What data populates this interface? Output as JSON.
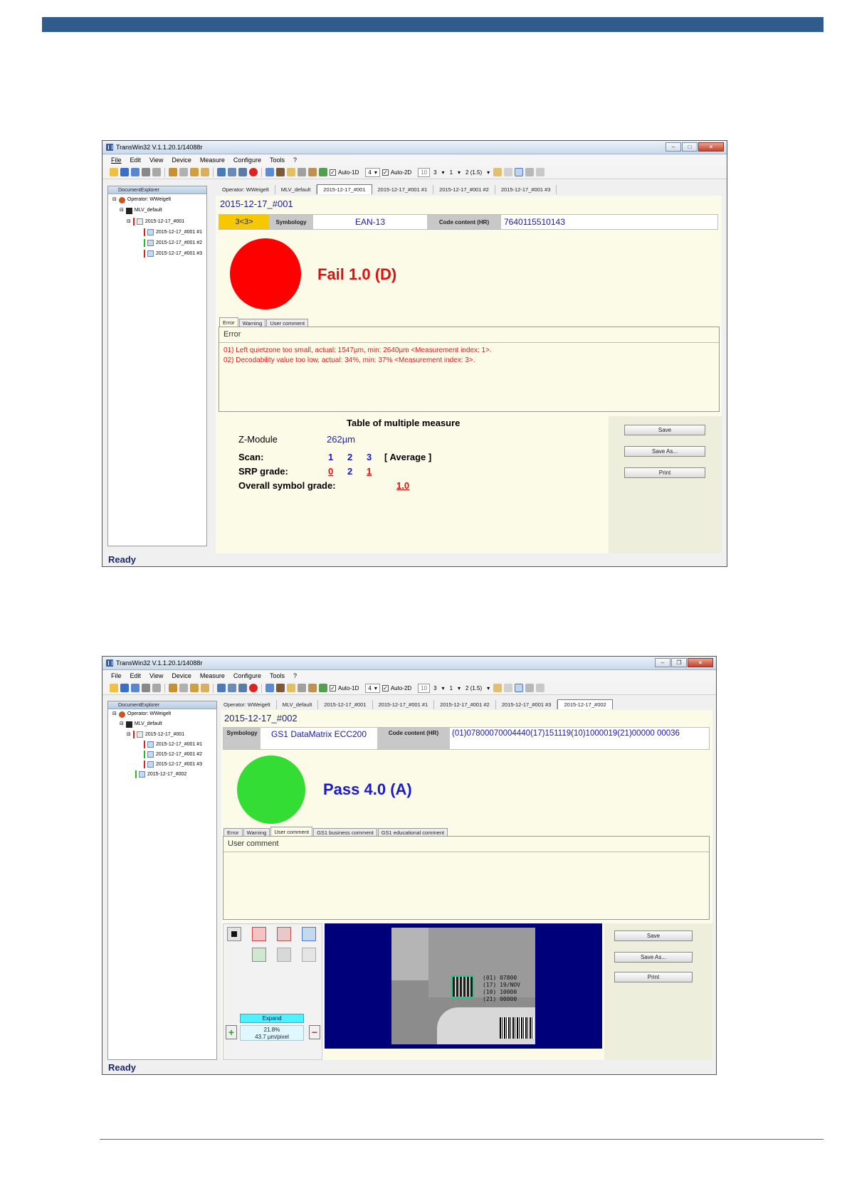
{
  "windows": [
    {
      "title": "TransWin32 V.1.1.20.1/14088r",
      "menu": [
        "File",
        "Edit",
        "View",
        "Device",
        "Measure",
        "Configure",
        "Tools",
        "?"
      ],
      "toolbar": {
        "auto1d_label": "Auto-1D",
        "combo1": "4",
        "auto2d_label": "Auto-2D",
        "spin": "10",
        "val_a": "3",
        "val_b": "1",
        "val_c": "2 (1.5)"
      },
      "explorer": {
        "header": "DocumentExplorer",
        "items": [
          "Operator: WWeigelt",
          "MLV_default",
          "2015-12-17_#001",
          "2015-12-17_#001 #1",
          "2015-12-17_#001 #2",
          "2015-12-17_#001 #3"
        ]
      },
      "tabs": [
        "Operator: WWeigelt",
        "MLV_default",
        "2015-12-17_#001",
        "2015-12-17_#001 #1",
        "2015-12-17_#001 #2",
        "2015-12-17_#001 #3"
      ],
      "doc_title": "2015-12-17_#001",
      "info": {
        "badge": "3<3>",
        "symbology_label": "Symbology",
        "symbology": "EAN-13",
        "code_label": "Code content (HR)",
        "code": "7640115510143"
      },
      "grade": {
        "text": "Fail 1.0 (D)",
        "color": "#ff0000"
      },
      "subtabs": [
        "Error",
        "Warning",
        "User comment"
      ],
      "messages": {
        "header": "Error",
        "lines": [
          "01) Left quietzone too small, actual: 1547µm, min: 2640µm <Measurement index: 1>.",
          "02) Decodability value too low, actual: 34%, min: 37% <Measurement index: 3>."
        ]
      },
      "measure": {
        "title": "Table of multiple measure",
        "zmodule_label": "Z-Module",
        "zmodule_value": "262µm",
        "scan_label": "Scan:",
        "scans": [
          "1",
          "2",
          "3"
        ],
        "average_label": "[ Average ]",
        "srp_label": "SRP grade:",
        "srp_values": [
          "0",
          "2",
          "1"
        ],
        "overall_label": "Overall symbol grade:",
        "overall_value": "1.0"
      },
      "buttons": [
        "Save",
        "Save As...",
        "Print"
      ],
      "status": "Ready"
    },
    {
      "title": "TransWin32 V.1.1.20.1/14088r",
      "menu": [
        "File",
        "Edit",
        "View",
        "Device",
        "Measure",
        "Configure",
        "Tools",
        "?"
      ],
      "toolbar": {
        "auto1d_label": "Auto-1D",
        "combo1": "4",
        "auto2d_label": "Auto-2D",
        "spin": "10",
        "val_a": "3",
        "val_b": "1",
        "val_c": "2 (1.5)"
      },
      "explorer": {
        "header": "DocumentExplorer",
        "items": [
          "Operator: WWeigelt",
          "MLV_default",
          "2015-12-17_#001",
          "2015-12-17_#001 #1",
          "2015-12-17_#001 #2",
          "2015-12-17_#001 #3",
          "2015-12-17_#002"
        ]
      },
      "tabs": [
        "Operator: WWeigelt",
        "MLV_default",
        "2015-12-17_#001",
        "2015-12-17_#001 #1",
        "2015-12-17_#001 #2",
        "2015-12-17_#001 #3",
        "2015-12-17_#002"
      ],
      "doc_title": "2015-12-17_#002",
      "info": {
        "symbology_label": "Symbology",
        "symbology": "GS1 DataMatrix ECC200",
        "code_label": "Code content (HR)",
        "code": "(01)07800070004440(17)151119(10)1000019(21)00000 00036"
      },
      "grade": {
        "text": "Pass 4.0 (A)",
        "color": "#33dd33"
      },
      "subtabs": [
        "Error",
        "Warning",
        "User comment",
        "GS1 business comment",
        "GS1 educational comment"
      ],
      "messages": {
        "header": "User comment"
      },
      "zoom": {
        "expand_label": "Expand",
        "percent": "21.8%",
        "scale": "43.7 µm/pixel"
      },
      "image_text": [
        "(01) 07800",
        "(17) 19/NOV",
        "(10) 10000",
        "(21) 00000"
      ],
      "buttons": [
        "Save",
        "Save As...",
        "Print"
      ],
      "status": "Ready"
    }
  ]
}
